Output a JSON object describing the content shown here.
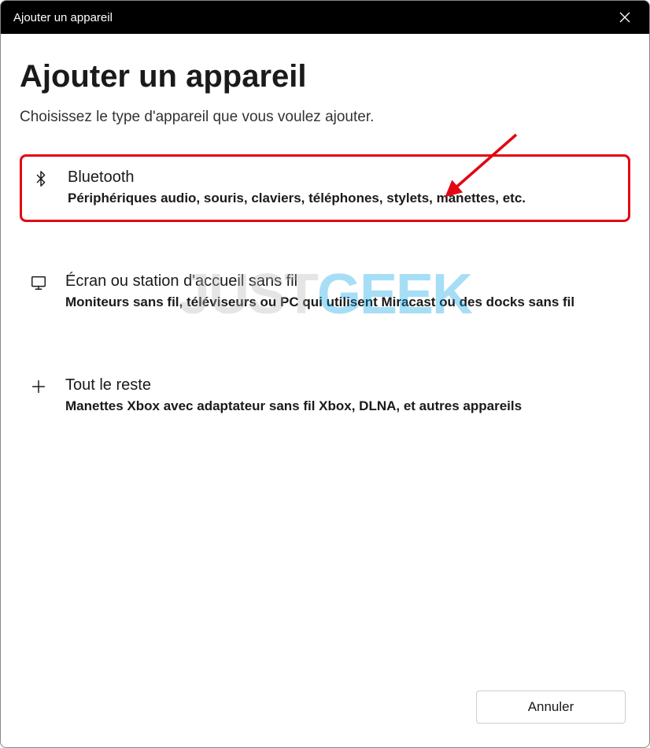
{
  "titlebar": {
    "title": "Ajouter un appareil"
  },
  "heading": "Ajouter un appareil",
  "subtitle": "Choisissez le type d'appareil que vous voulez ajouter.",
  "options": [
    {
      "title": "Bluetooth",
      "desc": "Périphériques audio, souris, claviers, téléphones, stylets, manettes, etc."
    },
    {
      "title": "Écran ou station d'accueil sans fil",
      "desc": "Moniteurs sans fil, téléviseurs ou PC qui utilisent Miracast ou des docks sans fil"
    },
    {
      "title": "Tout le reste",
      "desc": "Manettes Xbox avec adaptateur sans fil Xbox, DLNA, et autres appareils"
    }
  ],
  "footer": {
    "cancel": "Annuler"
  },
  "watermark": {
    "part1": "JUST",
    "part2": "GEEK"
  }
}
